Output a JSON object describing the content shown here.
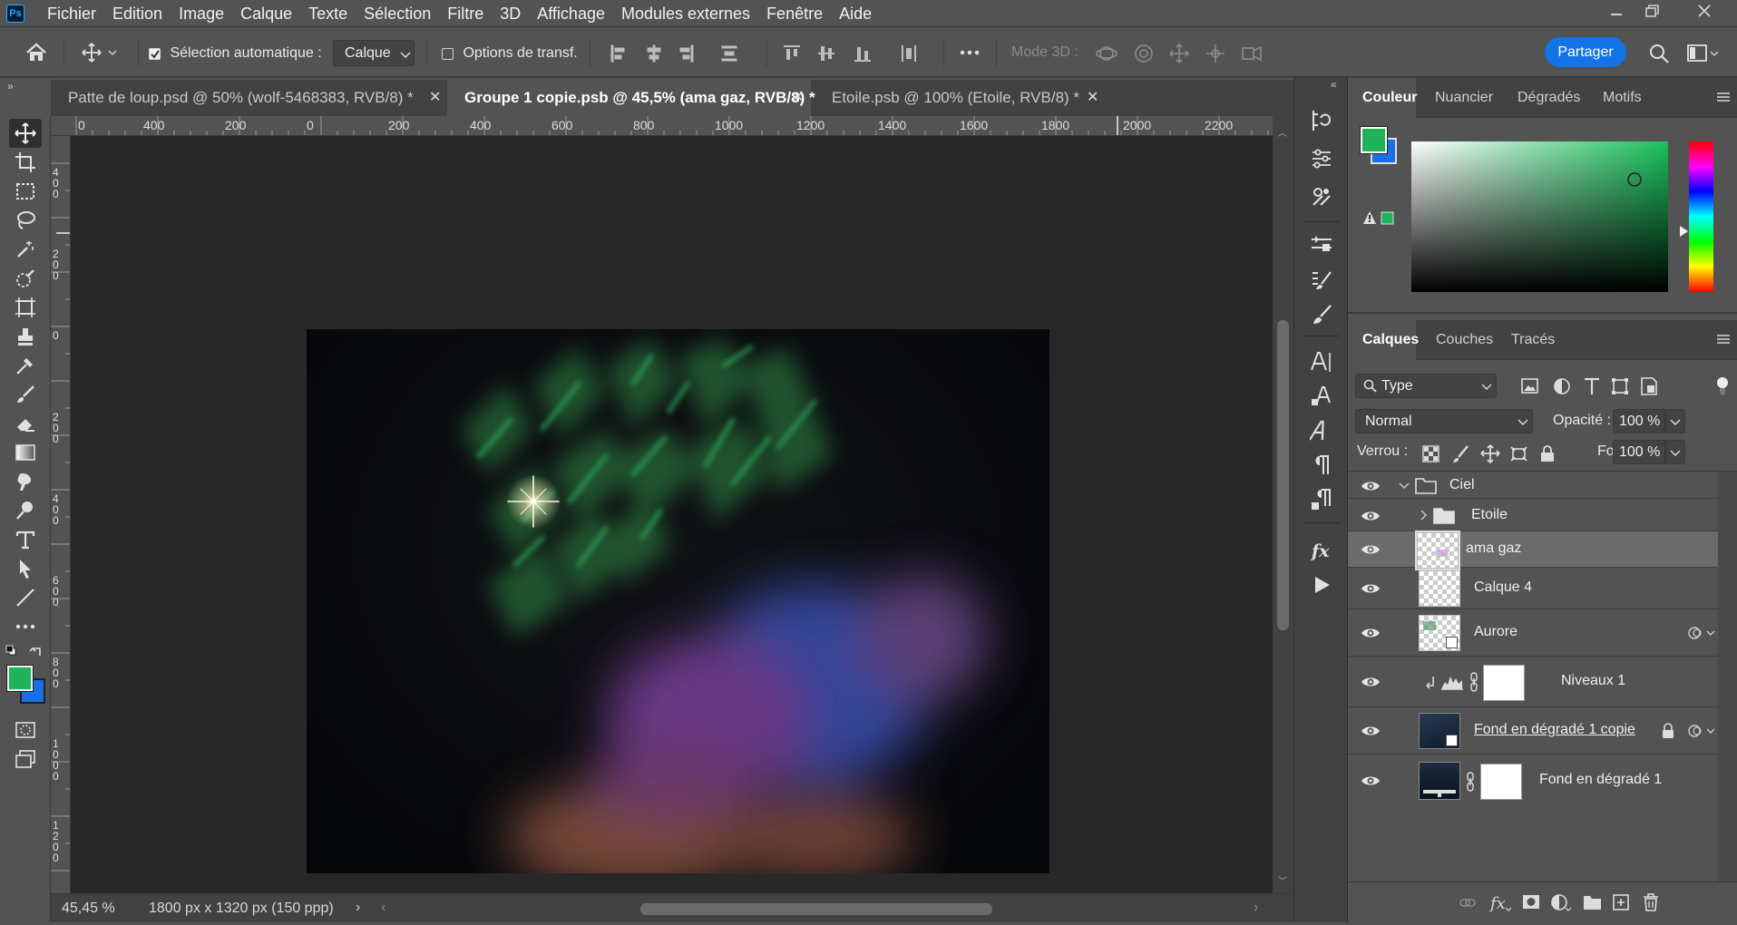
{
  "app": {
    "logo": "Ps"
  },
  "menu": [
    "Fichier",
    "Edition",
    "Image",
    "Calque",
    "Texte",
    "Sélection",
    "Filtre",
    "3D",
    "Affichage",
    "Modules externes",
    "Fenêtre",
    "Aide"
  ],
  "options": {
    "auto_select_label": "Sélection automatique :",
    "auto_select_value": "Calque",
    "transform_label": "Options de transf.",
    "mode3d_label": "Mode 3D :",
    "share_label": "Partager"
  },
  "tabs": [
    {
      "label": "Patte de loup.psd @ 50% (wolf-5468383, RVB/8) *",
      "active": false
    },
    {
      "label": "Groupe 1 copie.psb @ 45,5% (ama gaz, RVB/8) *",
      "active": true
    },
    {
      "label": "Etoile.psb @ 100% (Etoile, RVB/8) *",
      "active": false
    }
  ],
  "ruler_h": [
    "0",
    "400",
    "200",
    "0",
    "200",
    "400",
    "600",
    "800",
    "1000",
    "1200",
    "1400",
    "1600",
    "1800",
    "2000",
    "2200"
  ],
  "ruler_v": [
    "4\n0\n0",
    "2\n0\n0",
    "0",
    "2\n0\n0",
    "4\n0\n0",
    "6\n0\n0",
    "8\n0\n0",
    "1\n0\n0\n0",
    "1\n2\n0\n0"
  ],
  "status": {
    "zoom": "45,45 %",
    "doc_size": "1800 px x 1320 px (150 ppp)"
  },
  "colors": {
    "foreground": "#1fb35a",
    "background": "#1a6ee6",
    "accent": "#1473e6"
  },
  "color_panel": {
    "tabs": [
      "Couleur",
      "Nuancier",
      "Dégradés",
      "Motifs"
    ],
    "active_tab": "Couleur"
  },
  "layers_panel": {
    "tabs": [
      "Calques",
      "Couches",
      "Tracés"
    ],
    "active_tab": "Calques",
    "filter_value": "Type",
    "blend_mode": "Normal",
    "opacity_label": "Opacité :",
    "opacity_value": "100 %",
    "lock_label": "Verrou :",
    "fill_label": "Fond :",
    "fill_value": "100 %",
    "layers": [
      {
        "name": "Ciel",
        "kind": "group-open",
        "selected": false
      },
      {
        "name": "Etoile",
        "kind": "group-closed",
        "selected": false
      },
      {
        "name": "ama gaz",
        "kind": "pixel",
        "selected": true
      },
      {
        "name": "Calque 4",
        "kind": "pixel",
        "selected": false
      },
      {
        "name": "Aurore",
        "kind": "smart",
        "selected": false
      },
      {
        "name": "Niveaux 1",
        "kind": "adjustment",
        "selected": false
      },
      {
        "name": "Fond en dégradé 1 copie",
        "kind": "smart-locked",
        "selected": false
      },
      {
        "name": "Fond en dégradé 1",
        "kind": "fill",
        "selected": false
      }
    ]
  }
}
